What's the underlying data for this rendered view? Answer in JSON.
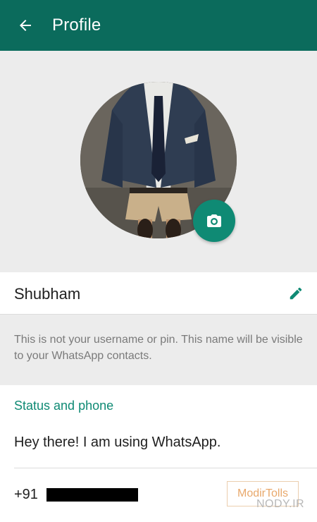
{
  "header": {
    "title": "Profile",
    "back_icon": "arrow-left-icon",
    "background": "#0b6b5c"
  },
  "profile": {
    "photo_icon": "camera-icon",
    "accent": "#0f8a74",
    "name": "Shubham",
    "edit_icon": "pencil-icon",
    "name_hint": "This is not your username or pin. This name will be visible to your WhatsApp contacts."
  },
  "status_section": {
    "title": "Status and phone",
    "status": "Hey there! I am using WhatsApp.",
    "phone_prefix": "+91"
  },
  "watermark": {
    "logo_text": "ModirTolls",
    "site": "NODY.IR"
  }
}
